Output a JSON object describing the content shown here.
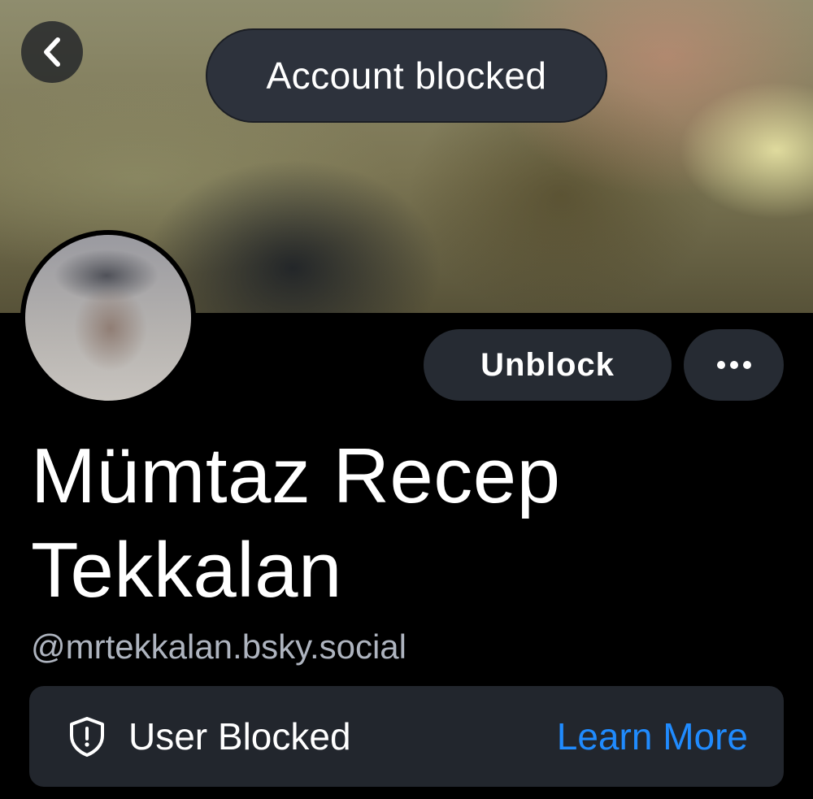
{
  "colors": {
    "background": "#000000",
    "button_bg": "#262b33",
    "banner_bg": "#22262d",
    "link": "#208bfe",
    "handle": "#aeb4bf"
  },
  "header": {
    "back_icon": "chevron-left-icon"
  },
  "toast": {
    "text": "Account blocked"
  },
  "actions": {
    "unblock_label": "Unblock",
    "more_icon": "ellipsis-icon"
  },
  "profile": {
    "name": "Mümtaz Recep Tekkalan",
    "handle": "@mrtekkalan.bsky.social"
  },
  "blocked_notice": {
    "icon": "shield-icon",
    "label": "User Blocked",
    "link_label": "Learn More"
  }
}
